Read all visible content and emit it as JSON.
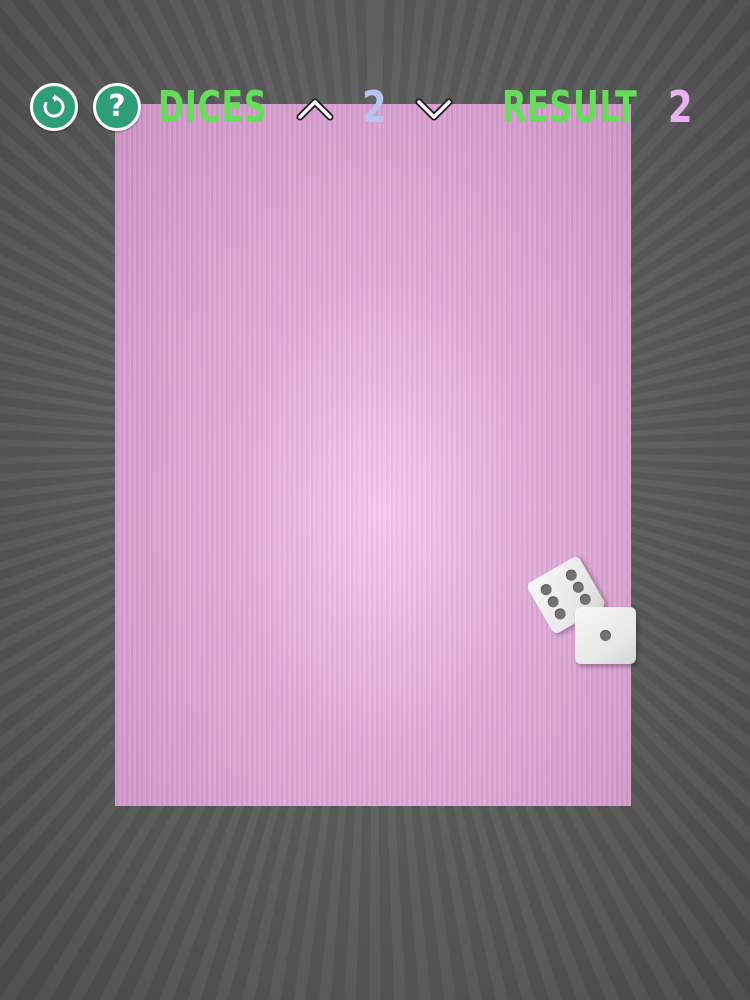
{
  "hud": {
    "restart_icon": "restart-icon",
    "help_glyph": "?",
    "dices_label": "DICES",
    "dice_count": "2",
    "increase_icon": "chevron-up-icon",
    "decrease_icon": "chevron-down-icon",
    "result_label": "RESULT",
    "result_value": "2"
  },
  "dice": [
    {
      "face": 6,
      "tilted": true
    },
    {
      "face": 1,
      "tilted": false
    }
  ],
  "colors": {
    "button_green": "#2f9d78",
    "label_green": "#67dd5e",
    "dice_count_color": "#b9c4ee",
    "result_value_color": "#e7b2ef",
    "board_pink": "#e0aad8",
    "backdrop_gray": "#5d5d5d",
    "pip_gray": "#737373"
  }
}
